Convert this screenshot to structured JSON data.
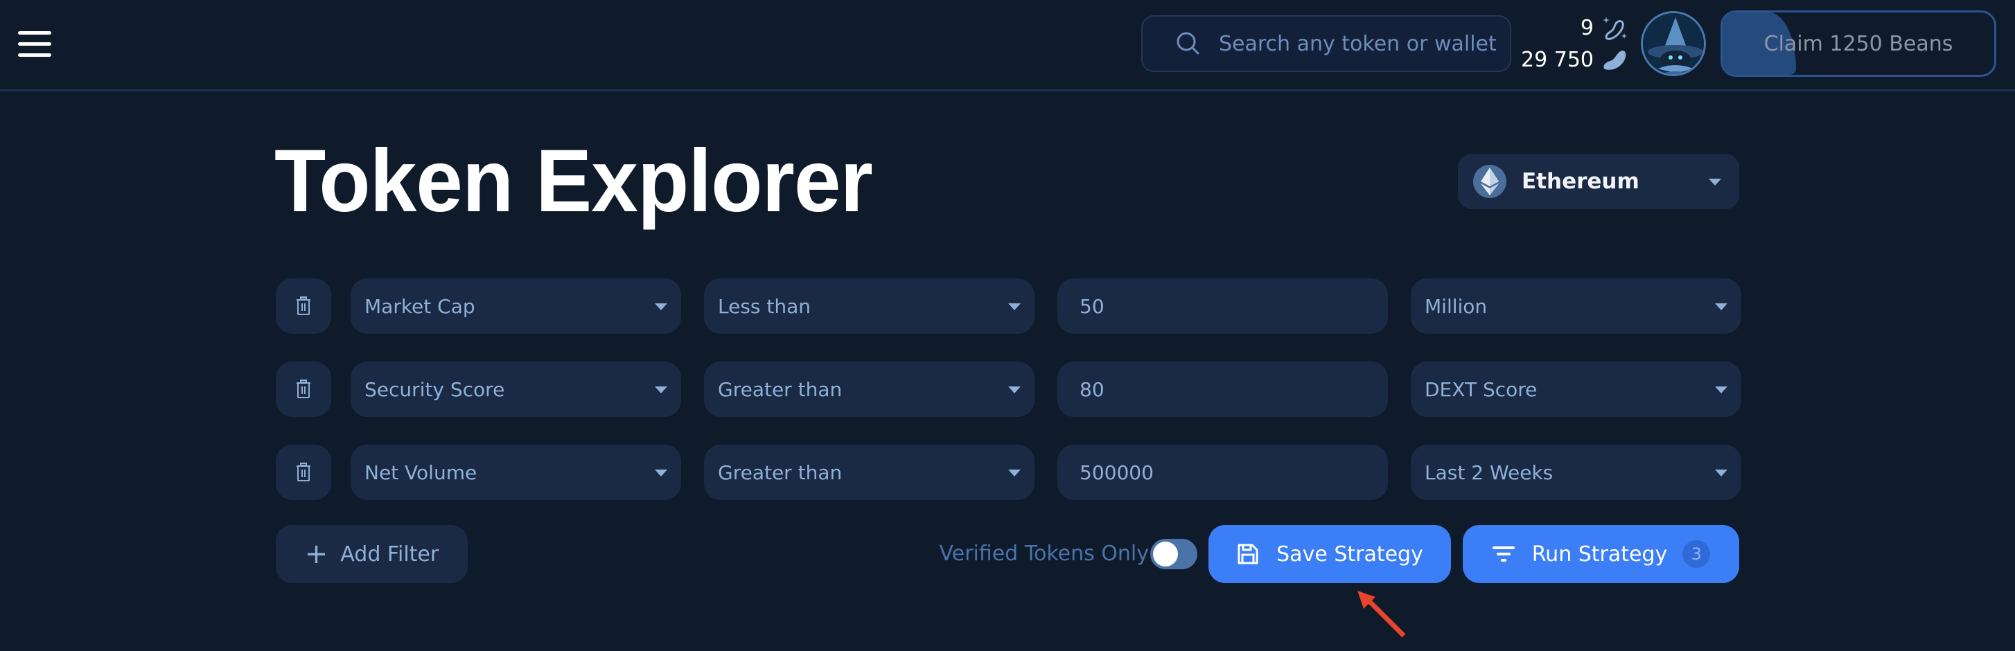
{
  "header": {
    "menu_icon": "hamburger-icon",
    "search": {
      "placeholder": "Search any token or wallet",
      "value": "",
      "icon": "search-icon"
    },
    "counters": [
      {
        "value": "9",
        "icon": "sparkle-bean-outline-icon"
      },
      {
        "value": "29 750",
        "icon": "bean-icon"
      }
    ],
    "avatar": {
      "icon": "wizard-avatar"
    },
    "claim": {
      "label": "Claim 1250 Beans",
      "progress_percent": 27
    }
  },
  "page": {
    "title": "Token Explorer",
    "chain_selector": {
      "value": "Ethereum",
      "icon": "ethereum-icon"
    }
  },
  "filters": [
    {
      "field": "Market Cap",
      "operator": "Less than",
      "value": "50",
      "unit": "Million"
    },
    {
      "field": "Security Score",
      "operator": "Greater than",
      "value": "80",
      "unit": "DEXT Score"
    },
    {
      "field": "Net Volume",
      "operator": "Greater than",
      "value": "500000",
      "unit": "Last 2 Weeks"
    }
  ],
  "actions": {
    "add_filter_label": "Add Filter",
    "verified_label": "Verified Tokens Only",
    "verified_on": false,
    "save_label": "Save Strategy",
    "run_label": "Run Strategy",
    "run_badge": "3"
  },
  "colors": {
    "background": "#0f1a2b",
    "panel": "#1b2a44",
    "accent": "#3b7ef5",
    "text_muted": "#8fb0d8",
    "annotation_arrow": "#e8432b"
  }
}
